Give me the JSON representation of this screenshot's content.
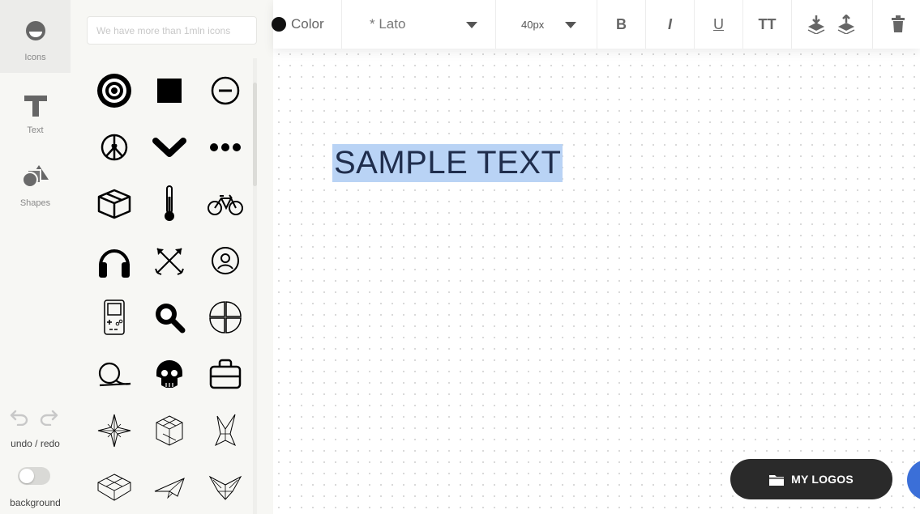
{
  "rail": {
    "icons_label": "Icons",
    "text_label": "Text",
    "shapes_label": "Shapes",
    "undo_redo_label": "undo / redo",
    "background_label": "background",
    "background_on": false
  },
  "panel": {
    "search_placeholder": "We have more than 1mln icons",
    "icons": [
      "bullseye-icon",
      "square-icon",
      "minus-circle-icon",
      "peace-heart-icon",
      "chevron-down-icon",
      "ellipsis-icon",
      "box-icon",
      "thermometer-icon",
      "bicycle-icon",
      "headphones-icon",
      "crossed-arrows-icon",
      "user-circle-icon",
      "gameboy-icon",
      "search-icon",
      "flower-petals-icon",
      "loop-q-icon",
      "skull-icon",
      "briefcase-icon",
      "compass-star-icon",
      "origami-cube-icon",
      "origami-crane-icon",
      "origami-box-icon",
      "paper-plane-icon",
      "origami-bird-icon"
    ]
  },
  "toolbar": {
    "color_label": "Color",
    "color_value": "#111111",
    "font_label": "* Lato",
    "size_label": "40px",
    "bold_label": "B",
    "italic_label": "I",
    "underline_label": "U",
    "caps_label": "TT"
  },
  "canvas": {
    "sample_text": "SAMPLE TEXT",
    "selection_color": "#b9d3f5",
    "text_color": "#1f2d4c"
  },
  "buttons": {
    "my_logos_label": "MY LOGOS",
    "accent": "#3b6fd8"
  }
}
